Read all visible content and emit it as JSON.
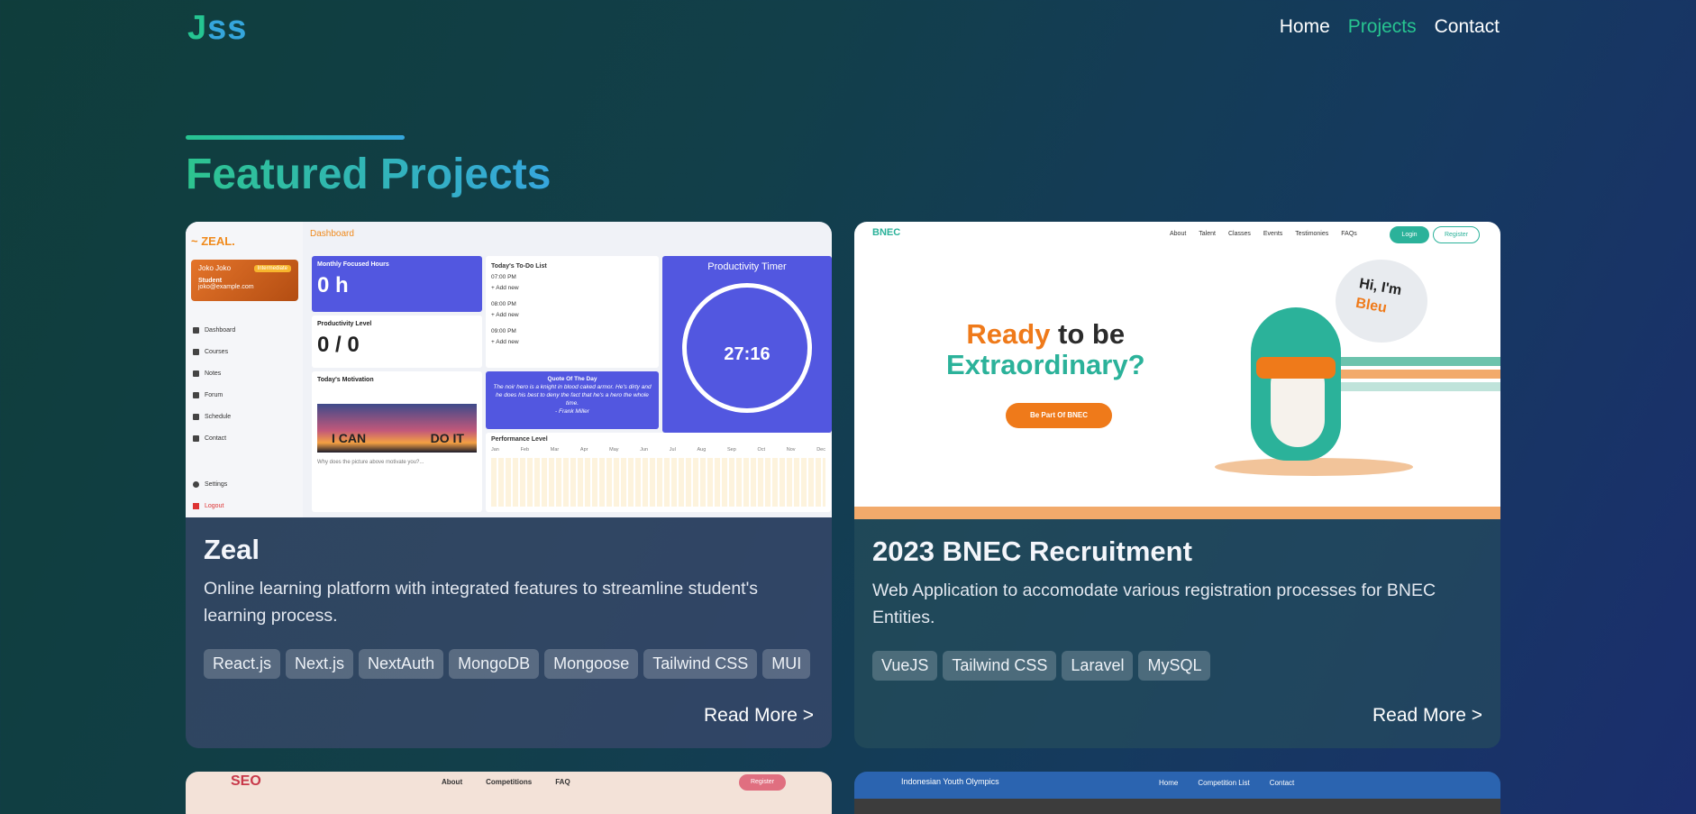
{
  "logo": {
    "part1": "J",
    "part2": "ss"
  },
  "nav": {
    "links": [
      {
        "label": "Home"
      },
      {
        "label": "Projects"
      },
      {
        "label": "Contact"
      }
    ]
  },
  "section": {
    "title": "Featured Projects"
  },
  "projects": [
    {
      "title": "Zeal",
      "description": "Online learning platform with integrated features to streamline student's learning process.",
      "tags": [
        "React.js",
        "Next.js",
        "NextAuth",
        "MongoDB",
        "Mongoose",
        "Tailwind CSS",
        "MUI"
      ],
      "read_more": "Read More >",
      "thumb": {
        "logo": "~ ZEAL.",
        "user_name": "Joko Joko",
        "user_role": "Student",
        "user_email": "joko@example.com",
        "user_badge": "Intermediate",
        "menu": [
          "Dashboard",
          "Courses",
          "Notes",
          "Forum",
          "Schedule",
          "Contact"
        ],
        "settings": "Settings",
        "logout": "Logout",
        "dashboard": "Dashboard",
        "monthly_label": "Monthly Focused Hours",
        "monthly_value": "0 h",
        "prod_label": "Productivity Level",
        "prod_value": "0 / 0",
        "motivation": "Today's Motivation",
        "motivation_q": "Why does the picture above motivate you?...",
        "img_left": "I CAN",
        "img_right": "DO IT",
        "todo_title": "Today's To-Do List",
        "todo_items": [
          "07:00 PM",
          "+ Add new",
          "08:00 PM",
          "+ Add new",
          "09:00 PM",
          "+ Add new"
        ],
        "quote_title": "Quote Of The Day",
        "quote_text": "The noir hero is a knight in blood caked armor. He's dirty and he does his best to deny the fact that he's a hero the whole time.",
        "quote_author": "- Frank Miller",
        "perf_title": "Performance Level",
        "months": [
          "Jan",
          "Feb",
          "Mar",
          "Apr",
          "May",
          "Jun",
          "Jul",
          "Aug",
          "Sep",
          "Oct",
          "Nov",
          "Dec"
        ],
        "timer_title": "Productivity Timer",
        "timer_value": "27:16"
      }
    },
    {
      "title": "2023 BNEC Recruitment",
      "description": "Web Application to accomodate various registration processes for BNEC Entities.",
      "tags": [
        "VueJS",
        "Tailwind CSS",
        "Laravel",
        "MySQL"
      ],
      "read_more": "Read More >",
      "thumb": {
        "logo": "BNEC",
        "nav": [
          "About",
          "Talent",
          "Classes",
          "Events",
          "Testimonies",
          "FAQs"
        ],
        "login": "Login",
        "register": "Register",
        "h1_a": "Ready",
        "h1_b": " to be",
        "h1_c": "Extraordinary?",
        "cta": "Be Part Of BNEC",
        "hi_a": "Hi, I'm",
        "hi_b": "Bleu"
      }
    },
    {
      "thumb": {
        "logo": "SEO",
        "nav": [
          "About",
          "Competitions",
          "FAQ"
        ],
        "register": "Register"
      }
    },
    {
      "thumb": {
        "title": "Indonesian Youth Olympics",
        "nav": [
          "Home",
          "Competition List",
          "Contact"
        ]
      }
    }
  ],
  "colors": {
    "accent": "#27c490",
    "accent2": "#35a6dc",
    "zeal_blue": "#5257e0",
    "bnec_teal": "#2bb29a",
    "bnec_orange": "#ef7a1a"
  }
}
